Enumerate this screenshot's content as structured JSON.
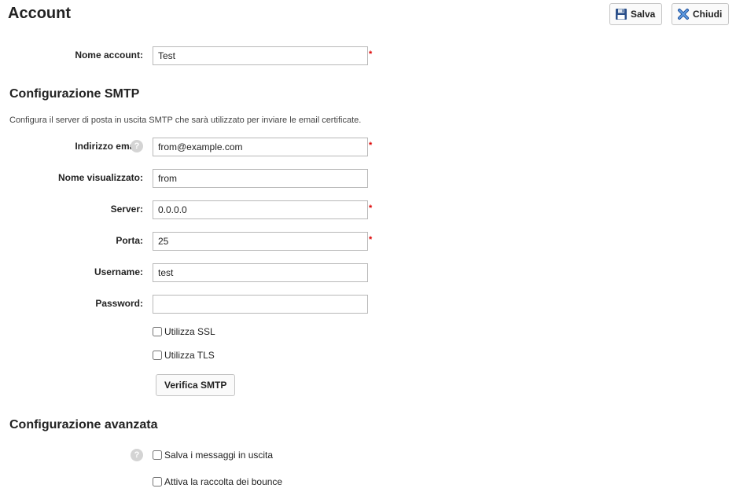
{
  "header": {
    "title": "Account",
    "save_label": "Salva",
    "close_label": "Chiudi"
  },
  "account": {
    "name_label": "Nome account:",
    "name_value": "Test"
  },
  "smtp": {
    "title": "Configurazione SMTP",
    "description": "Configura il server di posta in uscita SMTP che sarà utilizzato per inviare le email certificate.",
    "email_label": "Indirizzo email:",
    "email_value": "from@example.com",
    "display_label": "Nome visualizzato:",
    "display_value": "from",
    "server_label": "Server:",
    "server_value": "0.0.0.0",
    "port_label": "Porta:",
    "port_value": "25",
    "username_label": "Username:",
    "username_value": "test",
    "password_label": "Password:",
    "password_value": "",
    "ssl_label": "Utilizza SSL",
    "tls_label": "Utilizza TLS",
    "verify_label": "Verifica SMTP"
  },
  "advanced": {
    "title": "Configurazione avanzata",
    "save_outgoing_label": "Salva i messaggi in uscita",
    "bounce_label": "Attiva la raccolta dei bounce"
  },
  "required_marker": "*",
  "help_glyph": "?",
  "icons": {
    "save": "floppy-disk-icon",
    "close": "x-close-icon",
    "help": "question-mark-icon"
  },
  "colors": {
    "required": "#dd0000",
    "help_icon_bg": "#d4d4d4",
    "close_icon": "#2a6fc4",
    "save_icon": "#2a4f8a"
  }
}
